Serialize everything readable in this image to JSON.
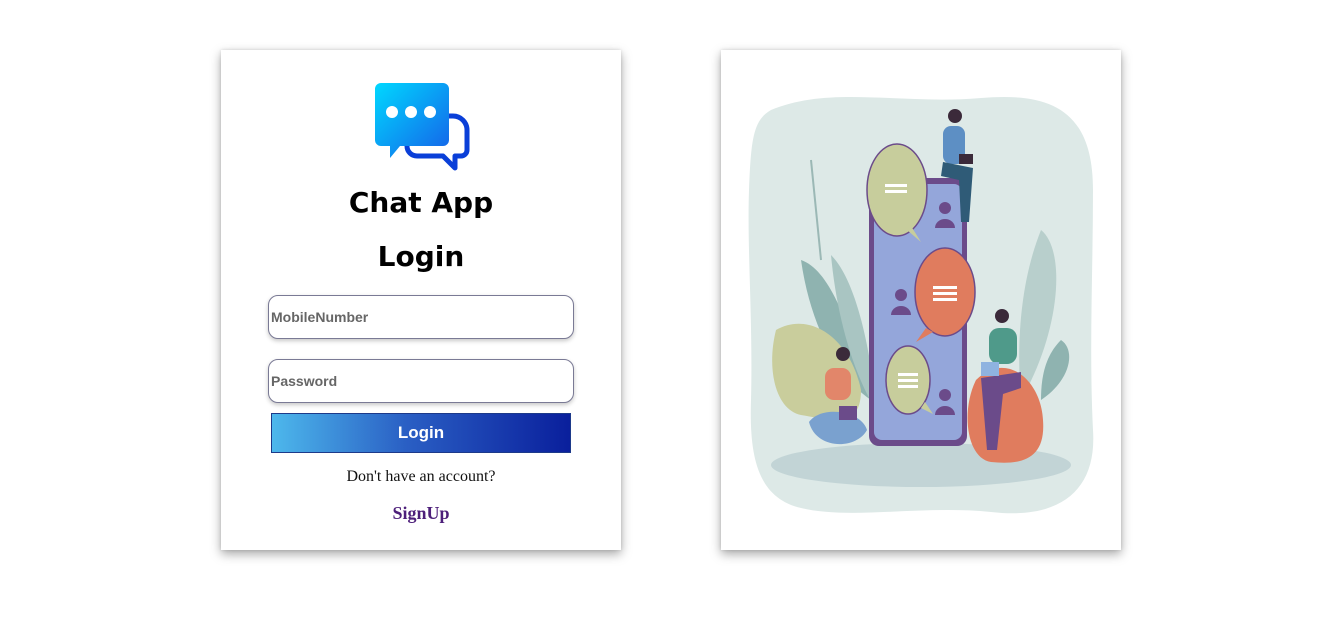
{
  "app": {
    "name": "Chat App",
    "heading": "Login"
  },
  "form": {
    "mobile_placeholder": "MobileNumber",
    "mobile_value": "",
    "password_placeholder": "Password",
    "password_value": "",
    "login_label": "Login"
  },
  "footer": {
    "account_text": "Don't have an account?",
    "signup_label": "SignUp"
  },
  "colors": {
    "button_gradient_start": "#4db8ec",
    "button_gradient_end": "#0a1f9c",
    "signup_link": "#4d1f7a",
    "logo_bubble": "#1ea0f5"
  },
  "icons": {
    "logo": "chat-bubbles-icon"
  }
}
